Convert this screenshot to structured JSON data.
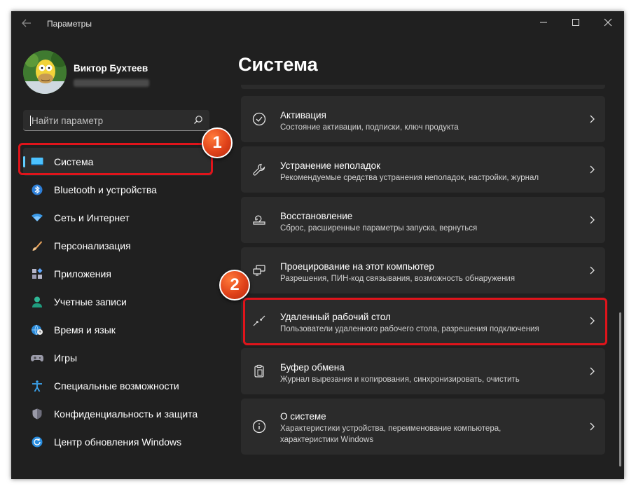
{
  "window": {
    "title": "Параметры"
  },
  "user": {
    "name": "Виктор Бухтеев"
  },
  "search": {
    "placeholder": "Найти параметр"
  },
  "sidebar": {
    "items": [
      {
        "label": "Система",
        "icon": "monitor-icon",
        "active": true
      },
      {
        "label": "Bluetooth и устройства",
        "icon": "bluetooth-icon"
      },
      {
        "label": "Сеть и Интернет",
        "icon": "wifi-icon"
      },
      {
        "label": "Персонализация",
        "icon": "brush-icon"
      },
      {
        "label": "Приложения",
        "icon": "apps-icon"
      },
      {
        "label": "Учетные записи",
        "icon": "person-icon"
      },
      {
        "label": "Время и язык",
        "icon": "globe-clock-icon"
      },
      {
        "label": "Игры",
        "icon": "gamepad-icon"
      },
      {
        "label": "Специальные возможности",
        "icon": "accessibility-icon"
      },
      {
        "label": "Конфиденциальность и защита",
        "icon": "shield-icon"
      },
      {
        "label": "Центр обновления Windows",
        "icon": "update-icon"
      }
    ]
  },
  "main": {
    "title": "Система",
    "cards": [
      {
        "title": "Активация",
        "subtitle": "Состояние активации, подписки, ключ продукта",
        "icon": "check-circle-icon"
      },
      {
        "title": "Устранение неполадок",
        "subtitle": "Рекомендуемые средства устранения неполадок, настройки, журнал",
        "icon": "wrench-icon"
      },
      {
        "title": "Восстановление",
        "subtitle": "Сброс, расширенные параметры запуска, вернуться",
        "icon": "recovery-icon"
      },
      {
        "title": "Проецирование на этот компьютер",
        "subtitle": "Разрешения, ПИН-код связывания, возможность обнаружения",
        "icon": "projection-icon"
      },
      {
        "title": "Удаленный рабочий стол",
        "subtitle": "Пользователи удаленного рабочего стола, разрешения подключения",
        "icon": "remote-desktop-icon"
      },
      {
        "title": "Буфер обмена",
        "subtitle": "Журнал вырезания и копирования, синхронизировать, очистить",
        "icon": "clipboard-icon"
      },
      {
        "title": "О системе",
        "subtitle": "Характеристики устройства, переименование компьютера, характеристики Windows",
        "icon": "info-icon"
      }
    ]
  },
  "annotations": {
    "badge1": "1",
    "badge2": "2",
    "color": "#e0141b"
  },
  "colors": {
    "accent": "#60cdff",
    "background": "#202020",
    "card": "#2b2b2b"
  }
}
